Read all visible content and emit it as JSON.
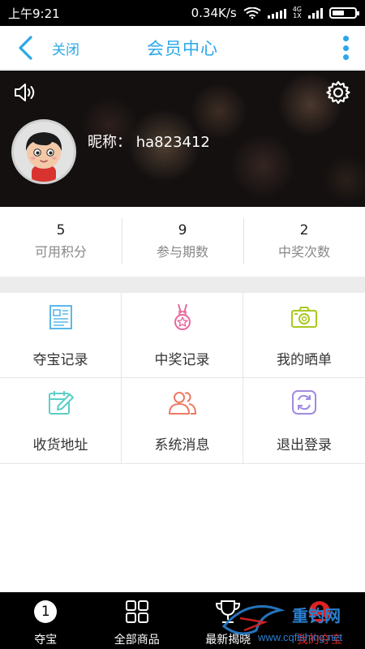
{
  "status_bar": {
    "time": "上午9:21",
    "speed": "0.34K/s",
    "net": "4G",
    "net_sub": "1X"
  },
  "header": {
    "close_label": "关闭",
    "title": "会员中心"
  },
  "profile": {
    "nick_label": "昵称：",
    "nick_value": "ha823412"
  },
  "stats": [
    {
      "value": "5",
      "label": "可用积分"
    },
    {
      "value": "9",
      "label": "参与期数"
    },
    {
      "value": "2",
      "label": "中奖次数"
    }
  ],
  "menu": [
    {
      "label": "夺宝记录",
      "icon": "document-icon",
      "color": "#5bb8e8"
    },
    {
      "label": "中奖记录",
      "icon": "medal-icon",
      "color": "#e86aa0"
    },
    {
      "label": "我的晒单",
      "icon": "camera-icon",
      "color": "#a8c820"
    },
    {
      "label": "收货地址",
      "icon": "edit-calendar-icon",
      "color": "#5bcfc8"
    },
    {
      "label": "系统消息",
      "icon": "users-icon",
      "color": "#ee7a66"
    },
    {
      "label": "退出登录",
      "icon": "refresh-icon",
      "color": "#a28ae0"
    }
  ],
  "bottom_nav": [
    {
      "label": "夺宝",
      "icon_text": "1"
    },
    {
      "label": "全部商品"
    },
    {
      "label": "最新揭晓"
    },
    {
      "label": "我的夺宝"
    }
  ],
  "watermark": {
    "brand": "重钓网",
    "url": "www.cqfishing.net"
  },
  "colors": {
    "accent": "#2aa7e8",
    "divider": "#e4e4e4",
    "nav_bg": "#000000"
  }
}
